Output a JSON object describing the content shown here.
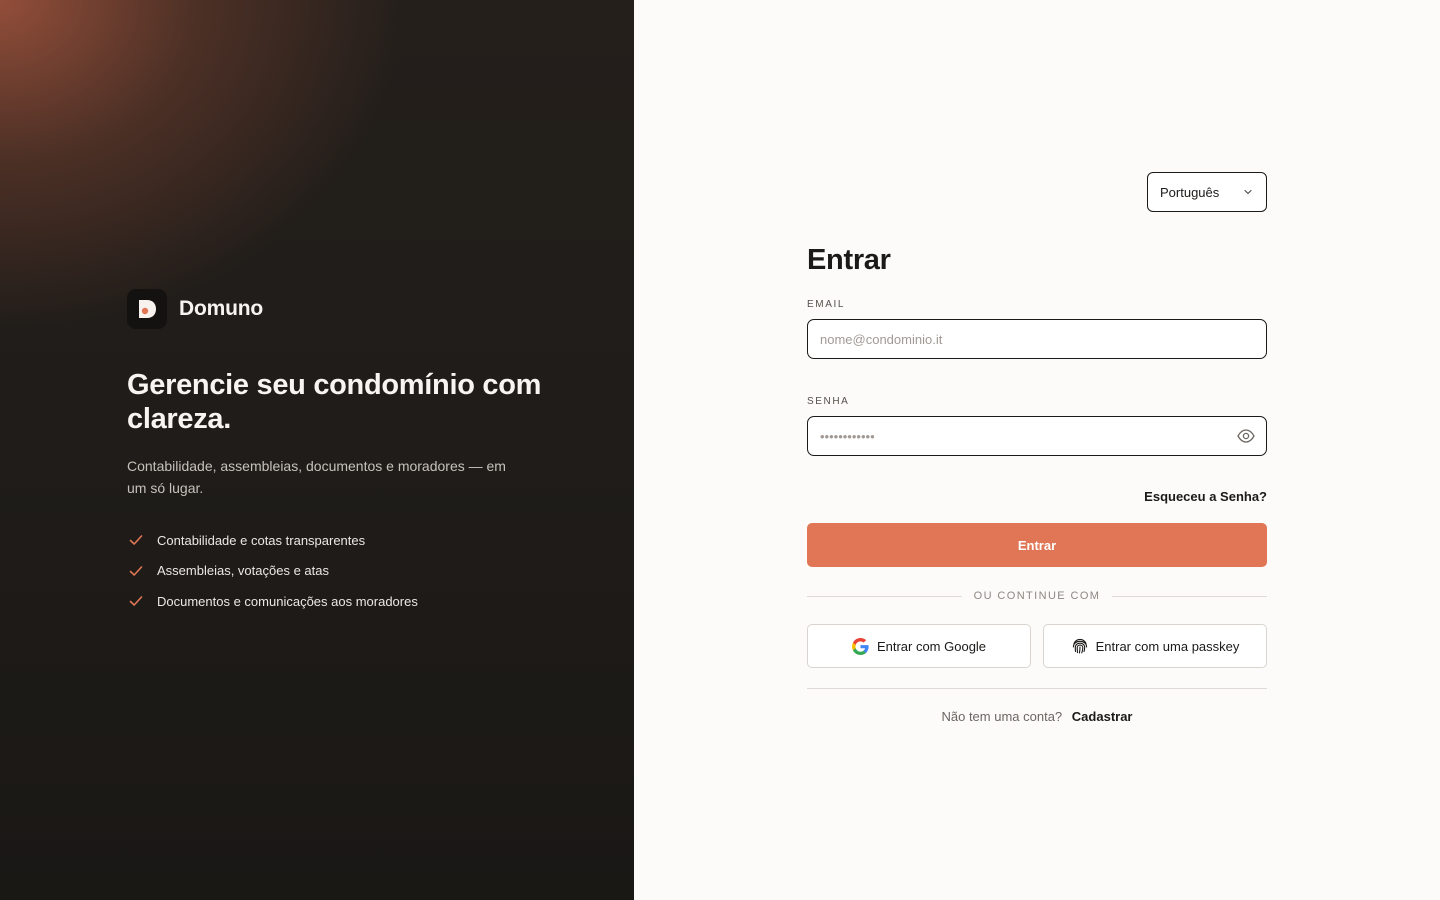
{
  "brand": {
    "name": "Domuno",
    "logo_letter": "D"
  },
  "hero": {
    "headline": "Gerencie seu condomínio com clareza.",
    "subline": "Contabilidade, assembleias, documentos e moradores — em um só lugar.",
    "features": [
      "Contabilidade e cotas transparentes",
      "Assembleias, votações e atas",
      "Documentos e comunicações aos moradores"
    ]
  },
  "language": {
    "selected": "Português"
  },
  "form": {
    "title": "Entrar",
    "email_label": "EMAIL",
    "email_placeholder": "nome@condominio.it",
    "password_label": "SENHA",
    "password_placeholder": "••••••••••••",
    "forgot_link": "Esqueceu a Senha?",
    "submit_label": "Entrar",
    "divider_text": "OU CONTINUE COM",
    "google_label": "Entrar com Google",
    "passkey_label": "Entrar com uma passkey",
    "no_account_text": "Não tem uma conta?",
    "signup_link": "Cadastrar"
  },
  "colors": {
    "accent": "#e07656",
    "dark_panel": "#1f1c19",
    "text": "#1c1a18"
  },
  "icons": {
    "check": "check-icon",
    "eye": "eye-icon",
    "chevron": "chevron-down-icon",
    "google": "google-icon",
    "passkey": "fingerprint-icon"
  }
}
